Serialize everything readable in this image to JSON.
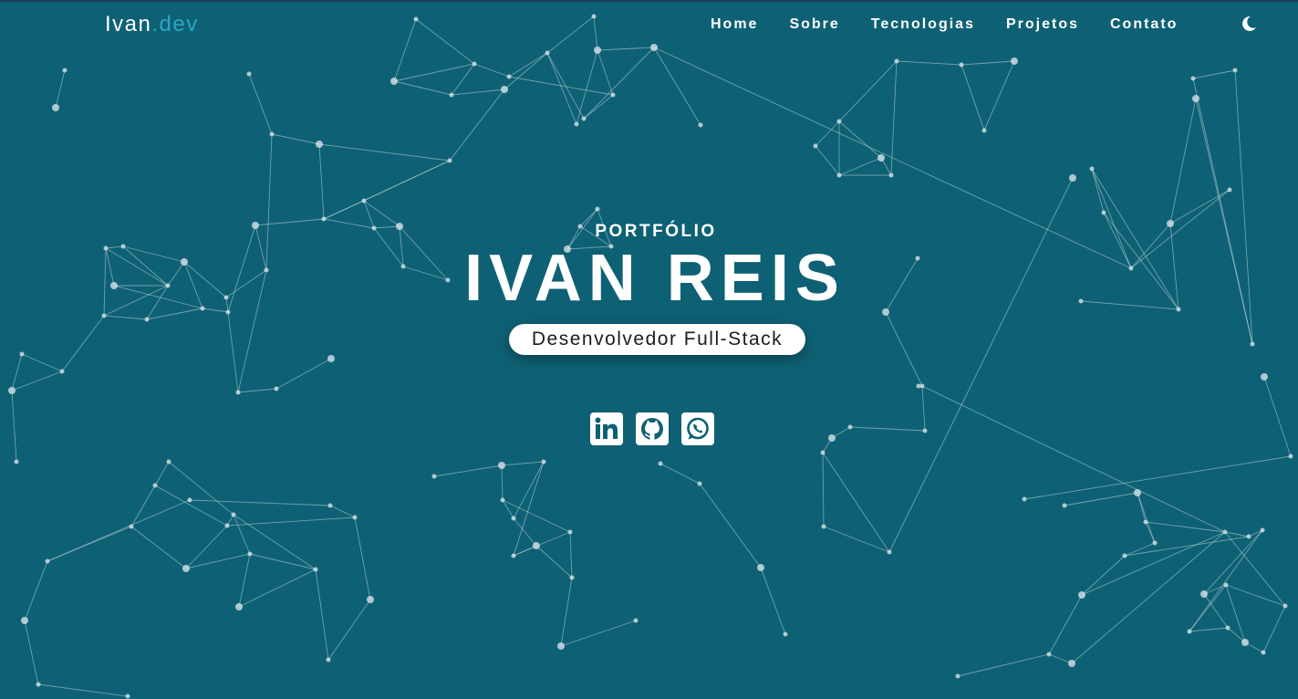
{
  "navbar": {
    "brand": {
      "name": "Ivan",
      "accent": ".dev"
    },
    "links": [
      {
        "label": "Home"
      },
      {
        "label": "Sobre"
      },
      {
        "label": "Tecnologias"
      },
      {
        "label": "Projetos"
      },
      {
        "label": "Contato"
      }
    ],
    "theme_toggle_icon": "moon-icon"
  },
  "hero": {
    "kicker": "PORTFÓLIO",
    "name": "IVAN REIS",
    "role": "Desenvolvedor Full-Stack"
  },
  "socials": [
    {
      "icon": "linkedin-icon"
    },
    {
      "icon": "github-icon"
    },
    {
      "icon": "whatsapp-icon"
    }
  ],
  "colors": {
    "background": "#0e6174",
    "accent": "#2aa7c4",
    "text": "#ffffff",
    "particle": "#d7e1e8"
  }
}
